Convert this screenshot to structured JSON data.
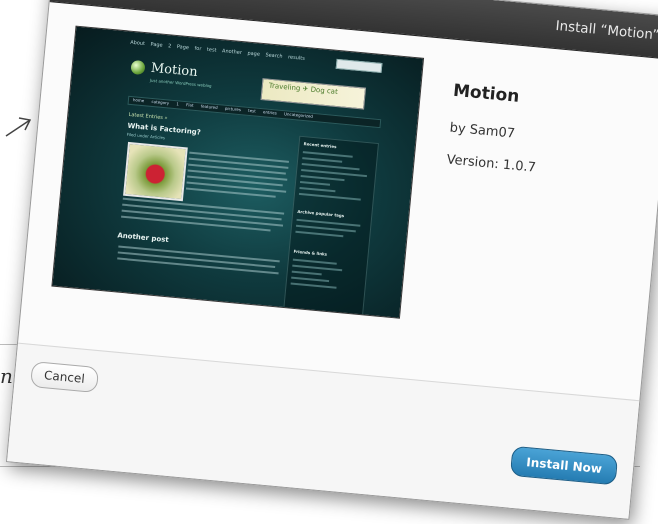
{
  "background": {
    "partial_text": "ne"
  },
  "dialog": {
    "title": "Install “Motion”",
    "close_label": "×",
    "theme": {
      "name": "Motion",
      "author": "by Sam07",
      "version": "Version: 1.0.7"
    },
    "preview": {
      "top_nav": "About Page 2 Page for test Another page Search results",
      "logo": "Motion",
      "tagline": "Just another WordPress weblog",
      "banner_text": "Traveling ✈ Dog cat",
      "menu": "home category 1 Flat featured pictures test entries Uncategorized",
      "latest": "Latest Entries »",
      "post_title": "What is Factoring?",
      "post_meta": "Filed under Articles",
      "post2_title": "Another post",
      "sidebar_recent": "Recent entries",
      "sidebar_tags": "Archive popular tags",
      "sidebar_links": "Friends & links"
    },
    "buttons": {
      "cancel": "Cancel",
      "install": "Install Now"
    }
  }
}
